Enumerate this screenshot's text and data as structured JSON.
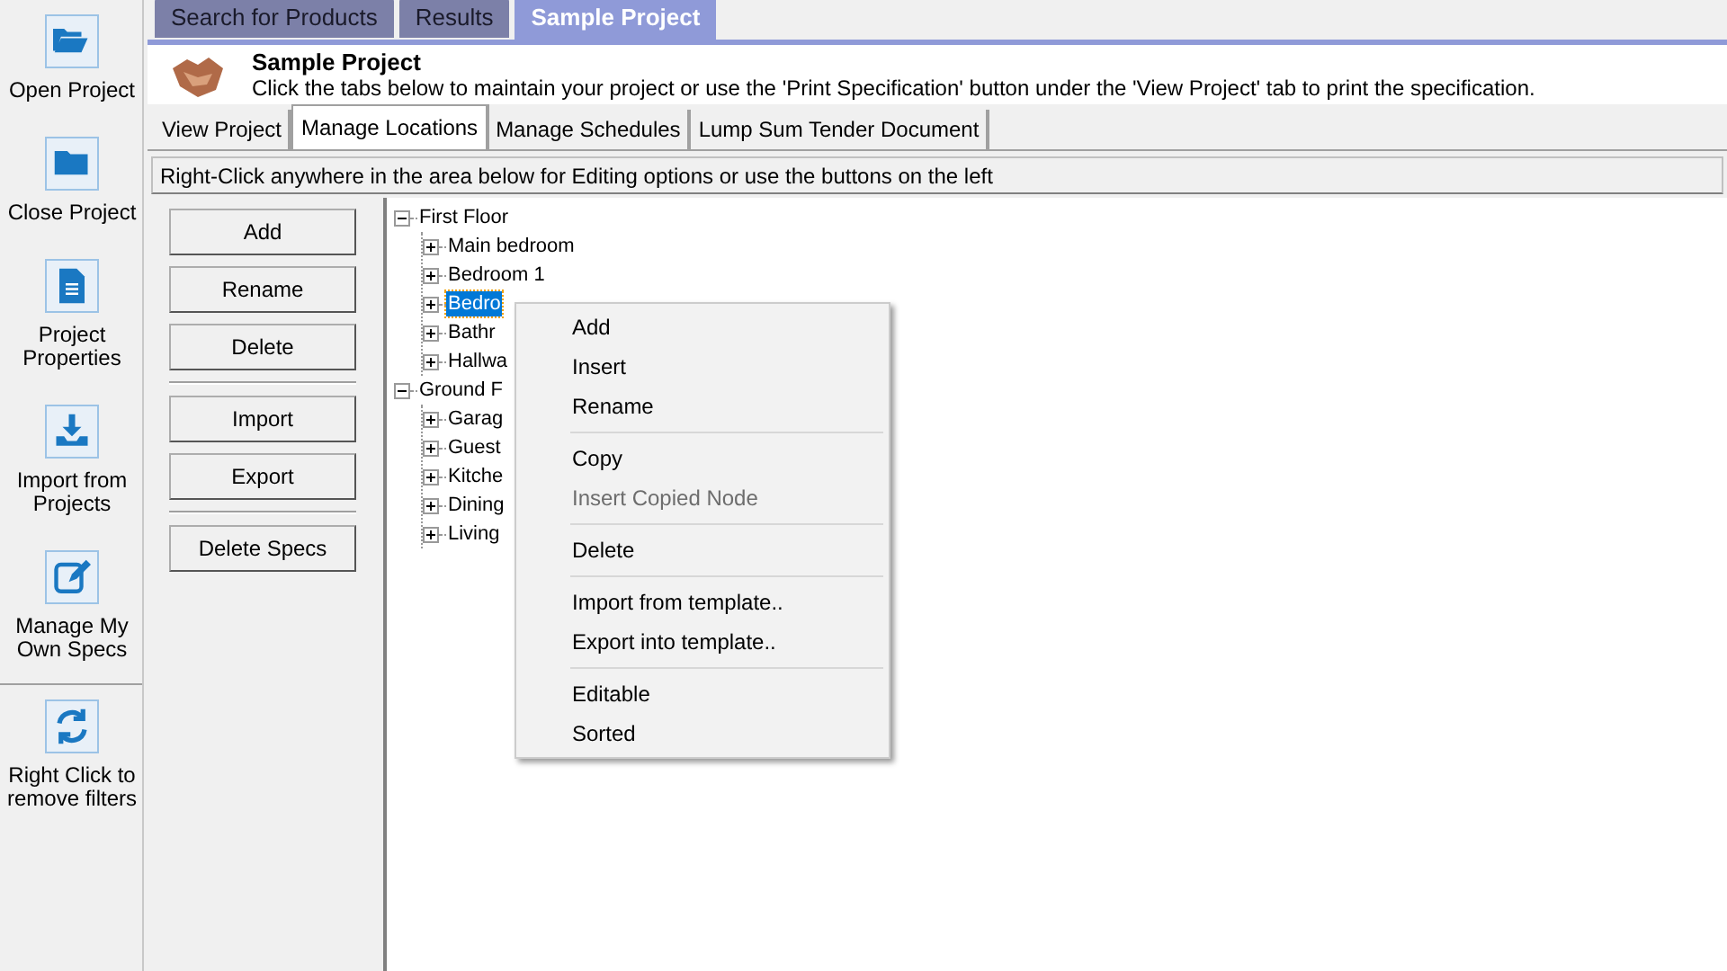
{
  "sidebar": {
    "items": [
      {
        "label": "Open Project"
      },
      {
        "label": "Close Project"
      },
      {
        "label": "Project Properties"
      },
      {
        "label": "Import from Projects"
      },
      {
        "label": "Manage My Own Specs"
      }
    ],
    "footer": {
      "label": "Right Click to remove filters"
    }
  },
  "top_tabs": [
    {
      "label": "Search for Products",
      "selected": false
    },
    {
      "label": "Results",
      "selected": false
    },
    {
      "label": "Sample Project",
      "selected": true
    }
  ],
  "header": {
    "title": "Sample Project",
    "description": "Click the tabs below to maintain your project or use the 'Print Specification' button under the 'View Project' tab to print the specification."
  },
  "sub_tabs": [
    {
      "label": "View Project",
      "selected": false
    },
    {
      "label": "Manage Locations",
      "selected": true
    },
    {
      "label": "Manage Schedules",
      "selected": false
    },
    {
      "label": "Lump Sum Tender Document",
      "selected": false
    }
  ],
  "hint": "Right-Click anywhere in the area below for Editing options or use the buttons on the left",
  "buttons": [
    {
      "kind": "button",
      "label": "Add"
    },
    {
      "kind": "button",
      "label": "Rename"
    },
    {
      "kind": "button",
      "label": "Delete"
    },
    {
      "kind": "separator"
    },
    {
      "kind": "button",
      "label": "Import"
    },
    {
      "kind": "button",
      "label": "Export"
    },
    {
      "kind": "separator"
    },
    {
      "kind": "button",
      "label": "Delete Specs"
    }
  ],
  "tree": [
    {
      "label": "First Floor",
      "expanded": true,
      "selected": false,
      "children": [
        {
          "label": "Main bedroom",
          "expanded": false,
          "selected": false
        },
        {
          "label": "Bedroom 1",
          "expanded": false,
          "selected": false
        },
        {
          "label": "Bedro",
          "expanded": false,
          "selected": true
        },
        {
          "label": "Bathr",
          "expanded": false,
          "selected": false
        },
        {
          "label": "Hallwa",
          "expanded": false,
          "selected": false
        }
      ]
    },
    {
      "label": "Ground F",
      "expanded": true,
      "selected": false,
      "children": [
        {
          "label": "Garag",
          "expanded": false,
          "selected": false
        },
        {
          "label": "Guest",
          "expanded": false,
          "selected": false
        },
        {
          "label": "Kitche",
          "expanded": false,
          "selected": false
        },
        {
          "label": "Dining",
          "expanded": false,
          "selected": false
        },
        {
          "label": "Living",
          "expanded": false,
          "selected": false
        }
      ]
    }
  ],
  "context_menu": [
    {
      "kind": "item",
      "label": "Add",
      "disabled": false
    },
    {
      "kind": "item",
      "label": "Insert",
      "disabled": false
    },
    {
      "kind": "item",
      "label": "Rename",
      "disabled": false
    },
    {
      "kind": "separator"
    },
    {
      "kind": "item",
      "label": "Copy",
      "disabled": false
    },
    {
      "kind": "item",
      "label": "Insert Copied Node",
      "disabled": true
    },
    {
      "kind": "separator"
    },
    {
      "kind": "item",
      "label": "Delete",
      "disabled": false
    },
    {
      "kind": "separator"
    },
    {
      "kind": "item",
      "label": "Import from template..",
      "disabled": false
    },
    {
      "kind": "item",
      "label": "Export into template..",
      "disabled": false
    },
    {
      "kind": "separator"
    },
    {
      "kind": "item",
      "label": "Editable",
      "disabled": false
    },
    {
      "kind": "item",
      "label": "Sorted",
      "disabled": false
    }
  ]
}
